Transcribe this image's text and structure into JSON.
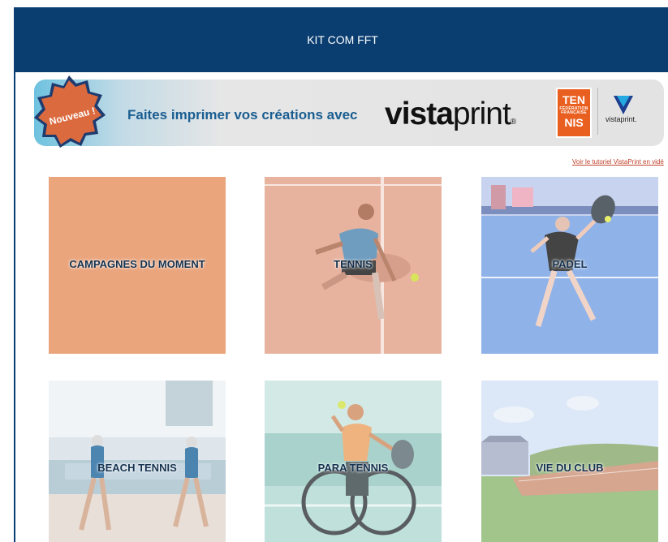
{
  "header": {
    "title": "KIT COM FFT"
  },
  "banner": {
    "badge": "Nouveau !",
    "promo": "Faites imprimer vos créations avec",
    "brand_bold": "vista",
    "brand_light": "print",
    "brand_mark": "®",
    "federation": {
      "line1": "TEN",
      "line2": "FÉDÉRATION FRANÇAISE",
      "line3": "NIS"
    },
    "partner": "vistaprint."
  },
  "tutorial_link": "Voir le tutoriel VistaPrint en vidé",
  "tiles": [
    {
      "label": "CAMPAGNES DU MOMENT"
    },
    {
      "label": "TENNIS"
    },
    {
      "label": "PADEL"
    },
    {
      "label": "BEACH TENNIS"
    },
    {
      "label": "PARA TENNIS"
    },
    {
      "label": "VIE DU CLUB"
    }
  ],
  "colors": {
    "header": "#0a3d70",
    "campaign_tile": "#eaa57d",
    "tennis_clay": "#e7b39f",
    "padel_blue": "#7fa6e2",
    "label": "#15324f"
  }
}
